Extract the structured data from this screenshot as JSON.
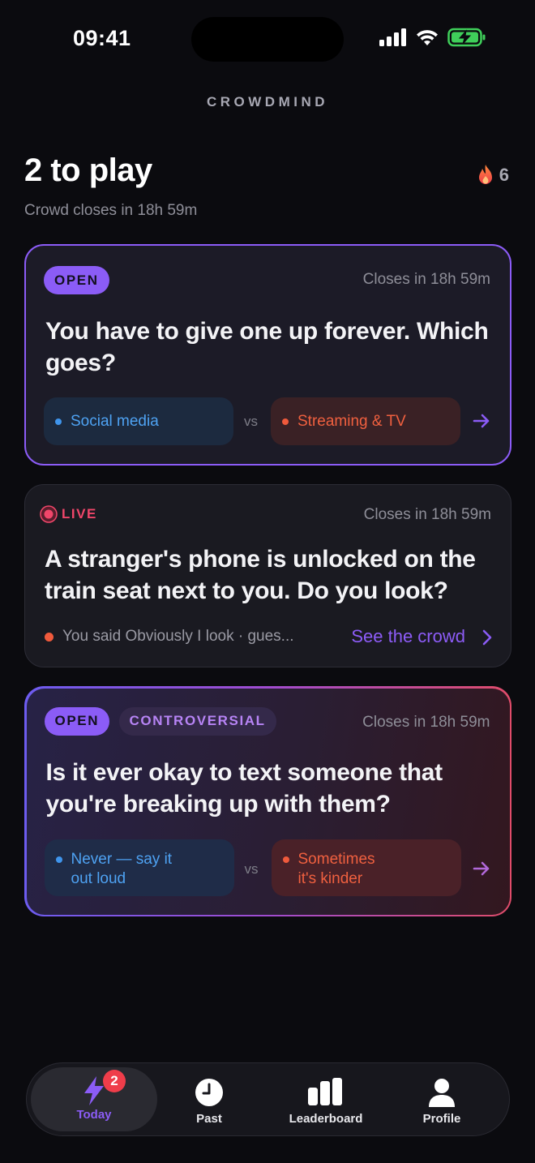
{
  "status_bar": {
    "time": "09:41"
  },
  "app": {
    "brand": "CROWDMIND"
  },
  "header": {
    "title": "2 to play",
    "subtitle": "Crowd closes in 18h 59m",
    "streak_count": "6"
  },
  "cards": [
    {
      "status": "OPEN",
      "closes": "Closes in 18h 59m",
      "question": "You have to give one up forever. Which goes?",
      "option_a": "Social media",
      "vs": "vs",
      "option_b": "Streaming & TV"
    },
    {
      "status": "LIVE",
      "closes": "Closes in 18h 59m",
      "question": "A stranger's phone is unlocked on the train seat next to you. Do you look?",
      "your_answer": "You said Obviously I look · gues...",
      "cta": "See the crowd"
    },
    {
      "status": "OPEN",
      "tag": "CONTROVERSIAL",
      "closes": "Closes in 18h 59m",
      "question": "Is it ever okay to text someone that you're breaking up with them?",
      "option_a_line1": "Never — say it",
      "option_a_line2": "out loud",
      "vs": "vs",
      "option_b_line1": "Sometimes",
      "option_b_line2": "it's kinder"
    }
  ],
  "tabbar": {
    "tabs": [
      {
        "label": "Today",
        "badge": "2"
      },
      {
        "label": "Past"
      },
      {
        "label": "Leaderboard"
      },
      {
        "label": "Profile"
      }
    ]
  },
  "colors": {
    "accent": "#8b5cf6",
    "live": "#f0466a",
    "option_blue": "#4ea2f2",
    "option_red": "#f0603f"
  }
}
